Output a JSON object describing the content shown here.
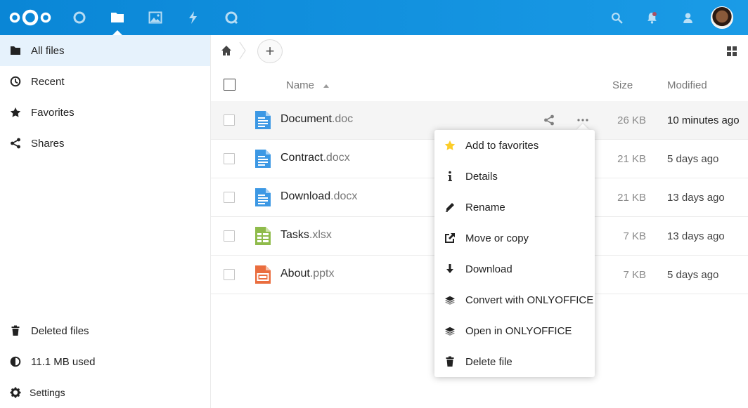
{
  "header": {
    "apps": [
      {
        "icon": "dashboard-icon"
      },
      {
        "icon": "files-icon"
      },
      {
        "icon": "photos-icon"
      },
      {
        "icon": "activity-icon"
      },
      {
        "icon": "talk-icon"
      }
    ],
    "right_icons": [
      "search-icon",
      "notifications-icon",
      "contacts-icon"
    ],
    "brand_color": "#0082c9"
  },
  "sidebar": {
    "items": [
      {
        "label": "All files",
        "icon": "folder-icon"
      },
      {
        "label": "Recent",
        "icon": "clock-icon"
      },
      {
        "label": "Favorites",
        "icon": "star-icon"
      },
      {
        "label": "Shares",
        "icon": "share-icon"
      }
    ],
    "bottom": {
      "deleted": "Deleted files",
      "quota": "11.1 MB used",
      "settings": "Settings"
    }
  },
  "table": {
    "columns": {
      "name": "Name",
      "size": "Size",
      "modified": "Modified"
    },
    "rows": [
      {
        "base": "Document",
        "ext": ".doc",
        "size": "26 KB",
        "modified": "10 minutes ago",
        "type": "document"
      },
      {
        "base": "Contract",
        "ext": ".docx",
        "size": "21 KB",
        "modified": "5 days ago",
        "type": "document"
      },
      {
        "base": "Download",
        "ext": ".docx",
        "size": "21 KB",
        "modified": "13 days ago",
        "type": "document"
      },
      {
        "base": "Tasks",
        "ext": ".xlsx",
        "size": "7 KB",
        "modified": "13 days ago",
        "type": "spreadsheet"
      },
      {
        "base": "About",
        "ext": ".pptx",
        "size": "7 KB",
        "modified": "5 days ago",
        "type": "presentation"
      }
    ]
  },
  "new_button": "+",
  "menu": {
    "items": [
      {
        "label": "Add to favorites",
        "icon": "star-icon"
      },
      {
        "label": "Details",
        "icon": "info-icon"
      },
      {
        "label": "Rename",
        "icon": "pencil-icon"
      },
      {
        "label": "Move or copy",
        "icon": "external-icon"
      },
      {
        "label": "Download",
        "icon": "download-icon"
      },
      {
        "label": "Convert with ONLYOFFICE",
        "icon": "layers-icon"
      },
      {
        "label": "Open in ONLYOFFICE",
        "icon": "layers-icon"
      },
      {
        "label": "Delete file",
        "icon": "trash-icon"
      }
    ]
  }
}
